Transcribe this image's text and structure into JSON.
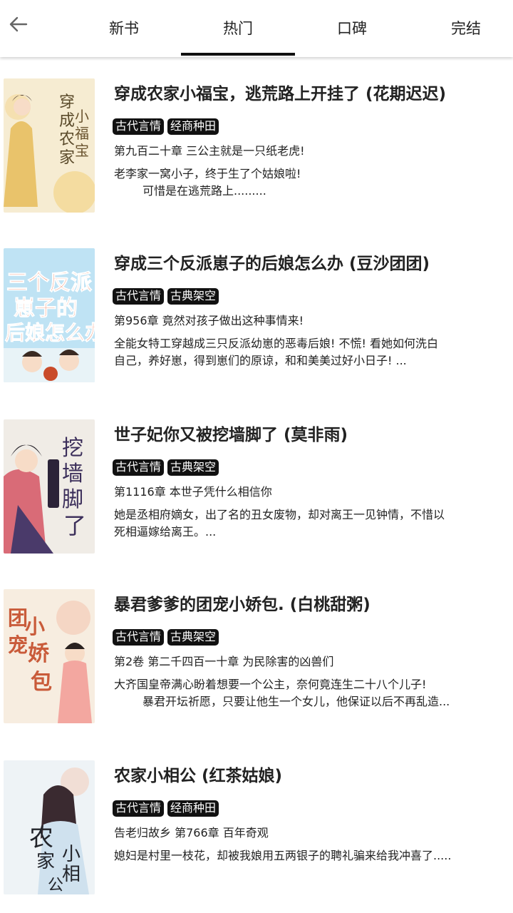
{
  "nav": {
    "tabs": [
      {
        "label": "新书"
      },
      {
        "label": "热门"
      },
      {
        "label": "口碑"
      },
      {
        "label": "完结"
      }
    ],
    "active_tab": "热门"
  },
  "books": [
    {
      "title": "穿成农家小福宝，逃荒路上开挂了 (花期迟迟)",
      "tags": [
        "古代言情",
        "经商种田"
      ],
      "chapter": "第九百二十章  三公主就是一只纸老虎!",
      "desc_line1": "老李家一窝小子，终于生了个姑娘啦!",
      "desc_line2": "可惜是在逃荒路上.........",
      "cover_text": "穿成农家小福宝"
    },
    {
      "title": "穿成三个反派崽子的后娘怎么办 (豆沙团团)",
      "tags": [
        "古代言情",
        "古典架空"
      ],
      "chapter": "第956章 竟然对孩子做出这种事情来!",
      "desc_line1": "全能女特工穿越成三只反派幼崽的恶毒后娘! 不慌! 看她如何洗白",
      "desc_line2": "自己，养好崽，得到崽们的原谅，和和美美过好小日子! ...",
      "cover_text": "三个反派崽子的后娘怎么办"
    },
    {
      "title": "世子妃你又被挖墙脚了 (莫非雨)",
      "tags": [
        "古代言情",
        "古典架空"
      ],
      "chapter": "第1116章 本世子凭什么相信你",
      "desc_line1": "她是丞相府嫡女，出了名的丑女废物，却对离王一见钟情，不惜以",
      "desc_line2": "死相逼嫁给离王。...",
      "cover_text": "挖墙脚了"
    },
    {
      "title": "暴君爹爹的团宠小娇包. (白桃甜粥)",
      "tags": [
        "古代言情",
        "古典架空"
      ],
      "chapter": "第2卷 第二千四百一十章 为民除害的凶兽们",
      "desc_line1": "大齐国皇帝满心盼着想要一个公主，奈何竟连生二十八个儿子!",
      "desc_line2": "暴君开坛祈愿，只要让他生一个女儿，他保证以后不再乱造...",
      "cover_text": "团宠小娇包"
    },
    {
      "title": "农家小相公 (红茶姑娘)",
      "tags": [
        "古代言情",
        "经商种田"
      ],
      "chapter": "告老归故乡 第766章 百年奇观",
      "desc_line1": "媳妇是村里一枝花，却被我娘用五两银子的聘礼骗来给我冲喜了.....",
      "desc_line2": "",
      "cover_text": "农家小相公"
    }
  ]
}
